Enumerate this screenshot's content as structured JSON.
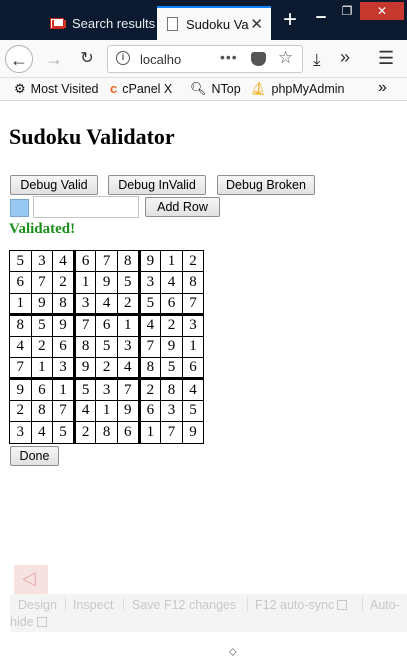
{
  "browser": {
    "tabs": [
      {
        "title": "Search results",
        "icon": "gmail-icon",
        "active": false
      },
      {
        "title": "Sudoku Va",
        "icon": "page-icon",
        "active": true
      }
    ],
    "url": "localho",
    "bookmarks": [
      {
        "label": "Most Visited",
        "icon": "gear-icon"
      },
      {
        "label": "cPanel X",
        "icon": "cpanel-icon"
      },
      {
        "label": "NTop",
        "icon": "search-icon"
      },
      {
        "label": "phpMyAdmin",
        "icon": "pma-icon"
      }
    ]
  },
  "page": {
    "title": "Sudoku Validator",
    "buttons": {
      "debug_valid": "Debug Valid",
      "debug_invalid": "Debug InValid",
      "debug_broken": "Debug Broken",
      "add_row": "Add Row",
      "done": "Done"
    },
    "row_input_value": "",
    "status": "Validated!",
    "status_color": "#1a8f1a",
    "grid": [
      [
        "5",
        "3",
        "4",
        "6",
        "7",
        "8",
        "9",
        "1",
        "2"
      ],
      [
        "6",
        "7",
        "2",
        "1",
        "9",
        "5",
        "3",
        "4",
        "8"
      ],
      [
        "1",
        "9",
        "8",
        "3",
        "4",
        "2",
        "5",
        "6",
        "7"
      ],
      [
        "8",
        "5",
        "9",
        "7",
        "6",
        "1",
        "4",
        "2",
        "3"
      ],
      [
        "4",
        "2",
        "6",
        "8",
        "5",
        "3",
        "7",
        "9",
        "1"
      ],
      [
        "7",
        "1",
        "3",
        "9",
        "2",
        "4",
        "8",
        "5",
        "6"
      ],
      [
        "9",
        "6",
        "1",
        "5",
        "3",
        "7",
        "2",
        "8",
        "4"
      ],
      [
        "2",
        "8",
        "7",
        "4",
        "1",
        "9",
        "6",
        "3",
        "5"
      ],
      [
        "3",
        "4",
        "5",
        "2",
        "8",
        "6",
        "1",
        "7",
        "9"
      ]
    ]
  },
  "dev_toolbar": {
    "design": "Design",
    "inspect": "Inspect",
    "save": "Save F12 changes",
    "autosync": "F12 auto-sync",
    "autohide_1": "Auto-",
    "autohide_2": "hide"
  }
}
